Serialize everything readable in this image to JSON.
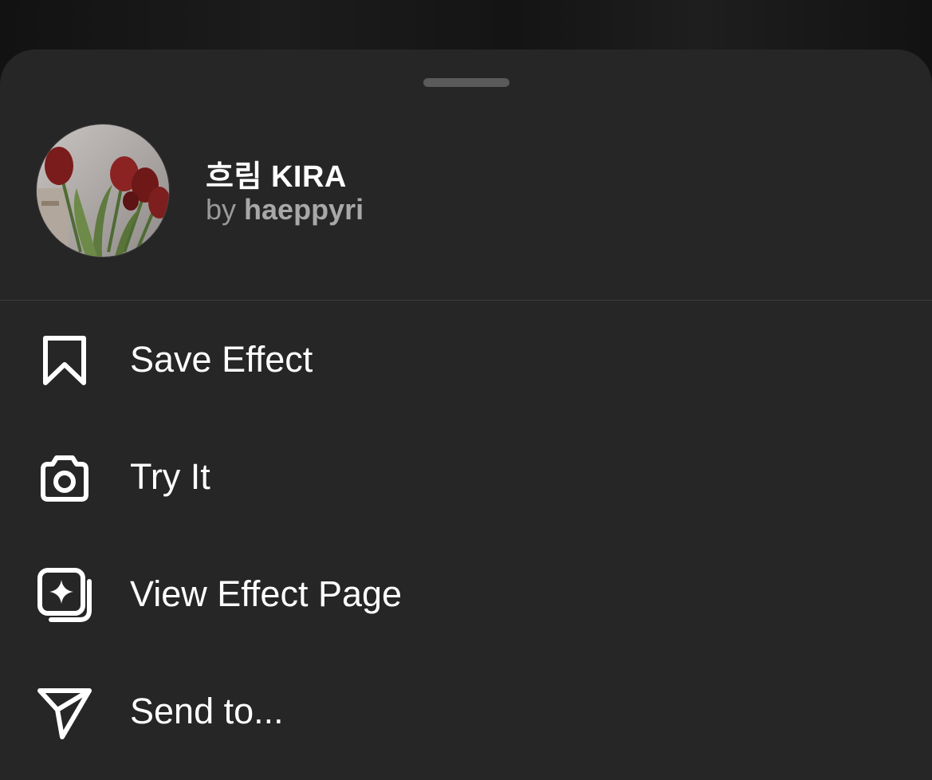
{
  "effect": {
    "title": "흐림 KIRA",
    "by_prefix": "by",
    "author": "haeppyri",
    "thumbnail_icon": "tulips-thumbnail"
  },
  "menu": {
    "items": [
      {
        "label": "Save Effect",
        "icon": "bookmark-icon"
      },
      {
        "label": "Try It",
        "icon": "camera-icon"
      },
      {
        "label": "View Effect Page",
        "icon": "effect-page-icon"
      },
      {
        "label": "Send to...",
        "icon": "send-icon"
      }
    ]
  },
  "colors": {
    "sheet_background": "#262626",
    "text_primary": "#ffffff",
    "text_secondary": "#9a9a9a"
  }
}
